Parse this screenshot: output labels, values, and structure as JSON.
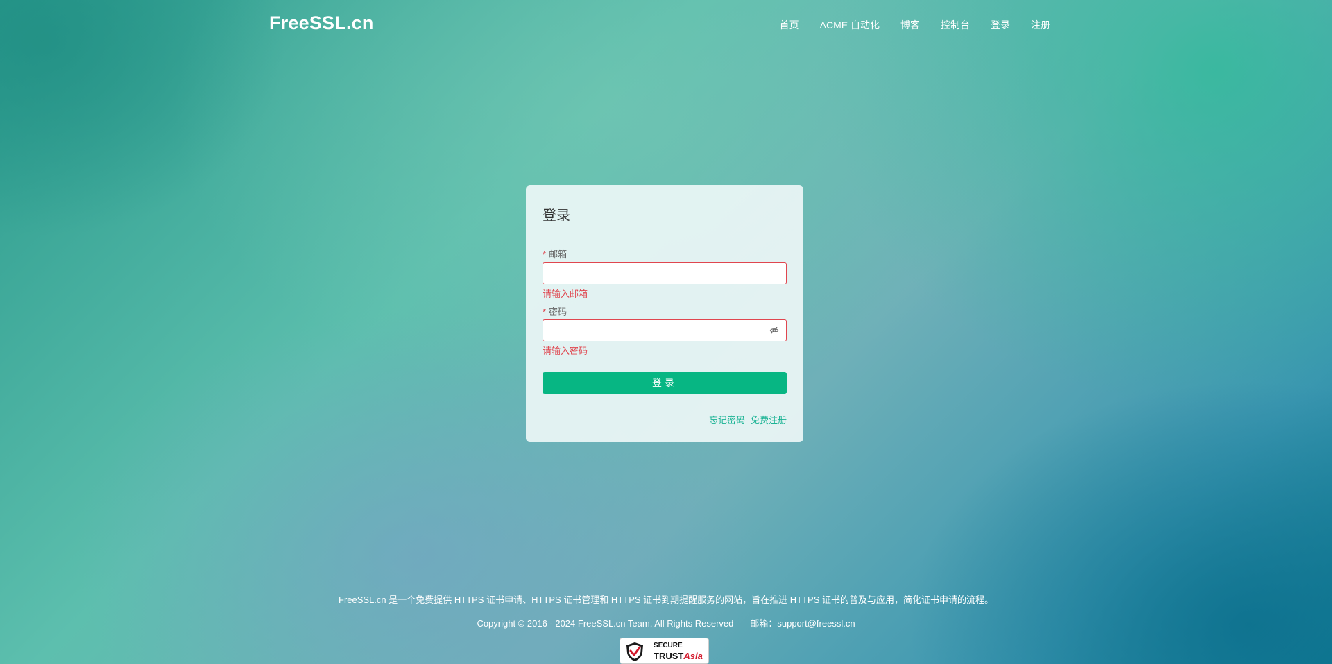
{
  "header": {
    "logo": "FreeSSL.cn",
    "nav": [
      "首页",
      "ACME 自动化",
      "博客",
      "控制台",
      "登录",
      "注册"
    ]
  },
  "login": {
    "title": "登录",
    "email": {
      "required_mark": "*",
      "label": "邮箱",
      "value": "",
      "error": "请输入邮箱"
    },
    "password": {
      "required_mark": "*",
      "label": "密码",
      "value": "",
      "error": "请输入密码"
    },
    "submit_label": "登录",
    "forgot_link": "忘记密码",
    "register_link": "免费注册"
  },
  "footer": {
    "description": "FreeSSL.cn 是一个免费提供 HTTPS 证书申请、HTTPS 证书管理和 HTTPS 证书到期提醒服务的网站，旨在推进 HTTPS 证书的普及与应用，简化证书申请的流程。",
    "copyright": "Copyright © 2016 - 2024 FreeSSL.cn Team, All Rights Reserved",
    "email": "邮箱：support@freessl.cn",
    "badge": {
      "line1": "SECURE",
      "line2_main": "TRUST",
      "line2_accent": "Asia"
    }
  },
  "colors": {
    "accent": "#07b683",
    "link": "#1ab394",
    "error": "#e0464f"
  }
}
